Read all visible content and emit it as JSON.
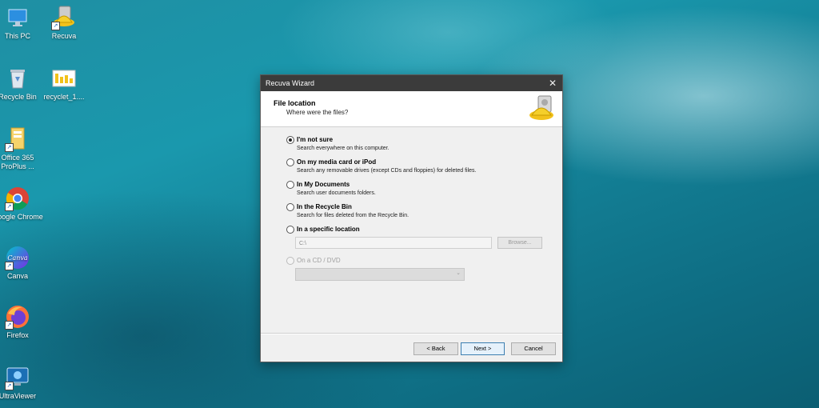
{
  "desktop": {
    "icons": [
      {
        "label": "This PC"
      },
      {
        "label": "Recuva"
      },
      {
        "label": "Recycle Bin"
      },
      {
        "label": "recyclet_1...."
      },
      {
        "label": "Office 365 ProPlus ..."
      },
      {
        "label": "Google Chrome"
      },
      {
        "label": "Canva"
      },
      {
        "label": "Firefox"
      },
      {
        "label": "UltraViewer"
      }
    ]
  },
  "dialog": {
    "title": "Recuva Wizard",
    "close_glyph": "✕",
    "header_title": "File location",
    "header_subtitle": "Where were the files?",
    "options": [
      {
        "label": "I'm not sure",
        "desc": "Search everywhere on this computer.",
        "checked": true
      },
      {
        "label": "On my media card or iPod",
        "desc": "Search any removable drives (except CDs and floppies) for deleted files."
      },
      {
        "label": "In My Documents",
        "desc": "Search user documents folders."
      },
      {
        "label": "In the Recycle Bin",
        "desc": "Search for files deleted from the Recycle Bin."
      },
      {
        "label": "In a specific location",
        "desc": ""
      },
      {
        "label": "On a CD / DVD",
        "desc": "",
        "disabled": true
      }
    ],
    "path_value": "C:\\",
    "browse_label": "Browse...",
    "back_label": "< Back",
    "next_label": "Next >",
    "cancel_label": "Cancel"
  }
}
